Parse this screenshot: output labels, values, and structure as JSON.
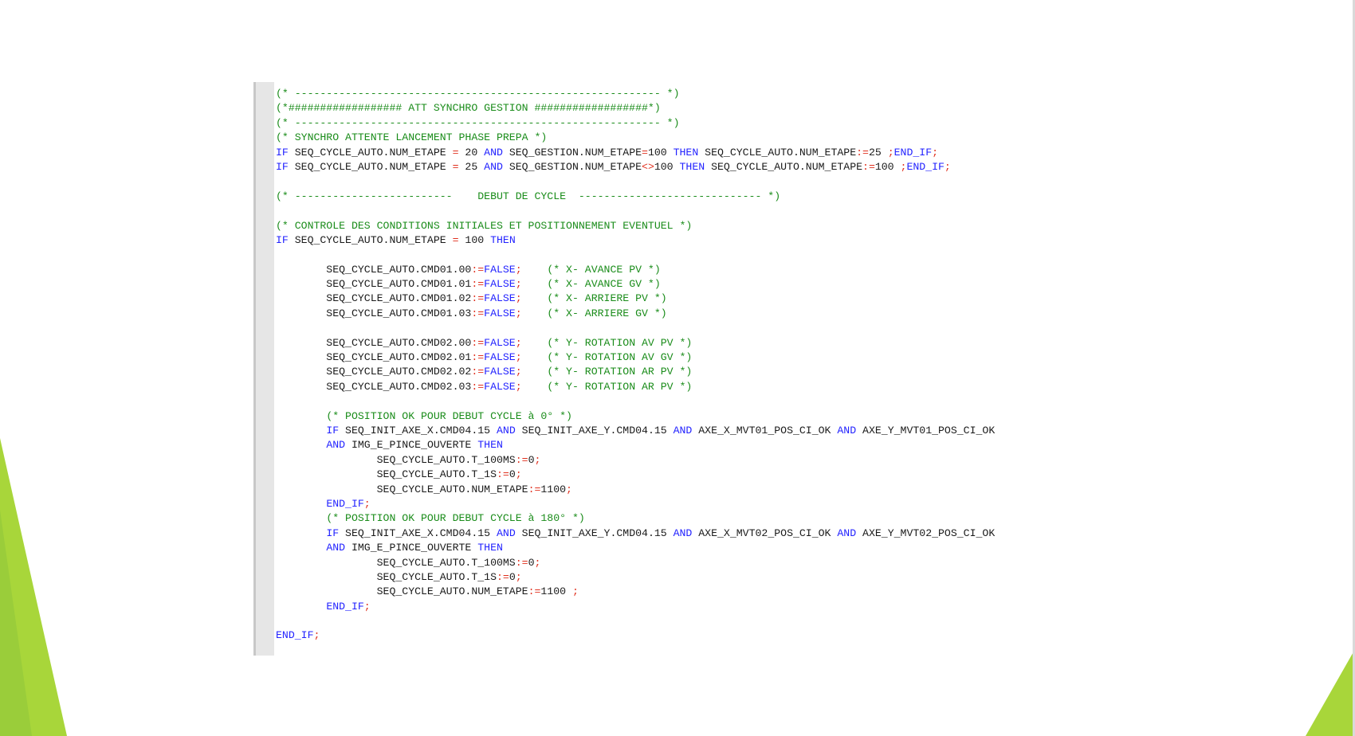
{
  "theme": {
    "accent_green_light": "#a8d63a",
    "accent_green_dark": "#6fae1f",
    "comment_color": "#1a8c1a",
    "keyword_color": "#2323ff",
    "operator_color": "#e0301e",
    "identifier_color": "#1a1a1a",
    "gutter_color": "#e6e6e6"
  },
  "editor": {
    "lines": [
      [
        {
          "t": "c",
          "v": "(* ---------------------------------------------------------- *)"
        }
      ],
      [
        {
          "t": "c",
          "v": "(*################## ATT SYNCHRO GESTION ##################*)"
        }
      ],
      [
        {
          "t": "c",
          "v": "(* ---------------------------------------------------------- *)"
        }
      ],
      [
        {
          "t": "c",
          "v": "(* SYNCHRO ATTENTE LANCEMENT PHASE PREPA *)"
        }
      ],
      [
        {
          "t": "k",
          "v": "IF"
        },
        {
          "t": "i",
          "v": " SEQ_CYCLE_AUTO.NUM_ETAPE "
        },
        {
          "t": "o",
          "v": "="
        },
        {
          "t": "i",
          "v": " 20 "
        },
        {
          "t": "k",
          "v": "AND"
        },
        {
          "t": "i",
          "v": " SEQ_GESTION.NUM_ETAPE"
        },
        {
          "t": "o",
          "v": "="
        },
        {
          "t": "i",
          "v": "100 "
        },
        {
          "t": "k",
          "v": "THEN"
        },
        {
          "t": "i",
          "v": " SEQ_CYCLE_AUTO.NUM_ETAPE"
        },
        {
          "t": "o",
          "v": ":="
        },
        {
          "t": "i",
          "v": "25 "
        },
        {
          "t": "o",
          "v": ";"
        },
        {
          "t": "k",
          "v": "END_IF"
        },
        {
          "t": "o",
          "v": ";"
        }
      ],
      [
        {
          "t": "k",
          "v": "IF"
        },
        {
          "t": "i",
          "v": " SEQ_CYCLE_AUTO.NUM_ETAPE "
        },
        {
          "t": "o",
          "v": "="
        },
        {
          "t": "i",
          "v": " 25 "
        },
        {
          "t": "k",
          "v": "AND"
        },
        {
          "t": "i",
          "v": " SEQ_GESTION.NUM_ETAPE"
        },
        {
          "t": "o",
          "v": "<>"
        },
        {
          "t": "i",
          "v": "100 "
        },
        {
          "t": "k",
          "v": "THEN"
        },
        {
          "t": "i",
          "v": " SEQ_CYCLE_AUTO.NUM_ETAPE"
        },
        {
          "t": "o",
          "v": ":="
        },
        {
          "t": "i",
          "v": "100 "
        },
        {
          "t": "o",
          "v": ";"
        },
        {
          "t": "k",
          "v": "END_IF"
        },
        {
          "t": "o",
          "v": ";"
        }
      ],
      [],
      [
        {
          "t": "c",
          "v": "(* -------------------------    DEBUT DE CYCLE  ----------------------------- *)"
        }
      ],
      [],
      [
        {
          "t": "c",
          "v": "(* CONTROLE DES CONDITIONS INITIALES ET POSITIONNEMENT EVENTUEL *)"
        }
      ],
      [
        {
          "t": "k",
          "v": "IF"
        },
        {
          "t": "i",
          "v": " SEQ_CYCLE_AUTO.NUM_ETAPE "
        },
        {
          "t": "o",
          "v": "="
        },
        {
          "t": "i",
          "v": " 100 "
        },
        {
          "t": "k",
          "v": "THEN"
        }
      ],
      [],
      [
        {
          "t": "i",
          "v": "        SEQ_CYCLE_AUTO.CMD01.00"
        },
        {
          "t": "o",
          "v": ":="
        },
        {
          "t": "k",
          "v": "FALSE"
        },
        {
          "t": "o",
          "v": ";"
        },
        {
          "t": "i",
          "v": "    "
        },
        {
          "t": "c",
          "v": "(* X- AVANCE PV *)"
        }
      ],
      [
        {
          "t": "i",
          "v": "        SEQ_CYCLE_AUTO.CMD01.01"
        },
        {
          "t": "o",
          "v": ":="
        },
        {
          "t": "k",
          "v": "FALSE"
        },
        {
          "t": "o",
          "v": ";"
        },
        {
          "t": "i",
          "v": "    "
        },
        {
          "t": "c",
          "v": "(* X- AVANCE GV *)"
        }
      ],
      [
        {
          "t": "i",
          "v": "        SEQ_CYCLE_AUTO.CMD01.02"
        },
        {
          "t": "o",
          "v": ":="
        },
        {
          "t": "k",
          "v": "FALSE"
        },
        {
          "t": "o",
          "v": ";"
        },
        {
          "t": "i",
          "v": "    "
        },
        {
          "t": "c",
          "v": "(* X- ARRIERE PV *)"
        }
      ],
      [
        {
          "t": "i",
          "v": "        SEQ_CYCLE_AUTO.CMD01.03"
        },
        {
          "t": "o",
          "v": ":="
        },
        {
          "t": "k",
          "v": "FALSE"
        },
        {
          "t": "o",
          "v": ";"
        },
        {
          "t": "i",
          "v": "    "
        },
        {
          "t": "c",
          "v": "(* X- ARRIERE GV *)"
        }
      ],
      [],
      [
        {
          "t": "i",
          "v": "        SEQ_CYCLE_AUTO.CMD02.00"
        },
        {
          "t": "o",
          "v": ":="
        },
        {
          "t": "k",
          "v": "FALSE"
        },
        {
          "t": "o",
          "v": ";"
        },
        {
          "t": "i",
          "v": "    "
        },
        {
          "t": "c",
          "v": "(* Y- ROTATION AV PV *)"
        }
      ],
      [
        {
          "t": "i",
          "v": "        SEQ_CYCLE_AUTO.CMD02.01"
        },
        {
          "t": "o",
          "v": ":="
        },
        {
          "t": "k",
          "v": "FALSE"
        },
        {
          "t": "o",
          "v": ";"
        },
        {
          "t": "i",
          "v": "    "
        },
        {
          "t": "c",
          "v": "(* Y- ROTATION AV GV *)"
        }
      ],
      [
        {
          "t": "i",
          "v": "        SEQ_CYCLE_AUTO.CMD02.02"
        },
        {
          "t": "o",
          "v": ":="
        },
        {
          "t": "k",
          "v": "FALSE"
        },
        {
          "t": "o",
          "v": ";"
        },
        {
          "t": "i",
          "v": "    "
        },
        {
          "t": "c",
          "v": "(* Y- ROTATION AR PV *)"
        }
      ],
      [
        {
          "t": "i",
          "v": "        SEQ_CYCLE_AUTO.CMD02.03"
        },
        {
          "t": "o",
          "v": ":="
        },
        {
          "t": "k",
          "v": "FALSE"
        },
        {
          "t": "o",
          "v": ";"
        },
        {
          "t": "i",
          "v": "    "
        },
        {
          "t": "c",
          "v": "(* Y- ROTATION AR PV *)"
        }
      ],
      [],
      [
        {
          "t": "i",
          "v": "        "
        },
        {
          "t": "c",
          "v": "(* POSITION OK POUR DEBUT CYCLE à 0° *)"
        }
      ],
      [
        {
          "t": "i",
          "v": "        "
        },
        {
          "t": "k",
          "v": "IF"
        },
        {
          "t": "i",
          "v": " SEQ_INIT_AXE_X.CMD04.15 "
        },
        {
          "t": "k",
          "v": "AND"
        },
        {
          "t": "i",
          "v": " SEQ_INIT_AXE_Y.CMD04.15 "
        },
        {
          "t": "k",
          "v": "AND"
        },
        {
          "t": "i",
          "v": " AXE_X_MVT01_POS_CI_OK "
        },
        {
          "t": "k",
          "v": "AND"
        },
        {
          "t": "i",
          "v": " AXE_Y_MVT01_POS_CI_OK"
        }
      ],
      [
        {
          "t": "i",
          "v": "        "
        },
        {
          "t": "k",
          "v": "AND"
        },
        {
          "t": "i",
          "v": " IMG_E_PINCE_OUVERTE "
        },
        {
          "t": "k",
          "v": "THEN"
        }
      ],
      [
        {
          "t": "i",
          "v": "                SEQ_CYCLE_AUTO.T_100MS"
        },
        {
          "t": "o",
          "v": ":="
        },
        {
          "t": "i",
          "v": "0"
        },
        {
          "t": "o",
          "v": ";"
        }
      ],
      [
        {
          "t": "i",
          "v": "                SEQ_CYCLE_AUTO.T_1S"
        },
        {
          "t": "o",
          "v": ":="
        },
        {
          "t": "i",
          "v": "0"
        },
        {
          "t": "o",
          "v": ";"
        }
      ],
      [
        {
          "t": "i",
          "v": "                SEQ_CYCLE_AUTO.NUM_ETAPE"
        },
        {
          "t": "o",
          "v": ":="
        },
        {
          "t": "i",
          "v": "1100"
        },
        {
          "t": "o",
          "v": ";"
        }
      ],
      [
        {
          "t": "i",
          "v": "        "
        },
        {
          "t": "k",
          "v": "END_IF"
        },
        {
          "t": "o",
          "v": ";"
        }
      ],
      [
        {
          "t": "i",
          "v": "        "
        },
        {
          "t": "c",
          "v": "(* POSITION OK POUR DEBUT CYCLE à 180° *)"
        }
      ],
      [
        {
          "t": "i",
          "v": "        "
        },
        {
          "t": "k",
          "v": "IF"
        },
        {
          "t": "i",
          "v": " SEQ_INIT_AXE_X.CMD04.15 "
        },
        {
          "t": "k",
          "v": "AND"
        },
        {
          "t": "i",
          "v": " SEQ_INIT_AXE_Y.CMD04.15 "
        },
        {
          "t": "k",
          "v": "AND"
        },
        {
          "t": "i",
          "v": " AXE_X_MVT02_POS_CI_OK "
        },
        {
          "t": "k",
          "v": "AND"
        },
        {
          "t": "i",
          "v": " AXE_Y_MVT02_POS_CI_OK"
        }
      ],
      [
        {
          "t": "i",
          "v": "        "
        },
        {
          "t": "k",
          "v": "AND"
        },
        {
          "t": "i",
          "v": " IMG_E_PINCE_OUVERTE "
        },
        {
          "t": "k",
          "v": "THEN"
        }
      ],
      [
        {
          "t": "i",
          "v": "                SEQ_CYCLE_AUTO.T_100MS"
        },
        {
          "t": "o",
          "v": ":="
        },
        {
          "t": "i",
          "v": "0"
        },
        {
          "t": "o",
          "v": ";"
        }
      ],
      [
        {
          "t": "i",
          "v": "                SEQ_CYCLE_AUTO.T_1S"
        },
        {
          "t": "o",
          "v": ":="
        },
        {
          "t": "i",
          "v": "0"
        },
        {
          "t": "o",
          "v": ";"
        }
      ],
      [
        {
          "t": "i",
          "v": "                SEQ_CYCLE_AUTO.NUM_ETAPE"
        },
        {
          "t": "o",
          "v": ":="
        },
        {
          "t": "i",
          "v": "1100 "
        },
        {
          "t": "o",
          "v": ";"
        }
      ],
      [
        {
          "t": "i",
          "v": "        "
        },
        {
          "t": "k",
          "v": "END_IF"
        },
        {
          "t": "o",
          "v": ";"
        }
      ],
      [],
      [
        {
          "t": "k",
          "v": "END_IF"
        },
        {
          "t": "o",
          "v": ";"
        }
      ]
    ]
  }
}
